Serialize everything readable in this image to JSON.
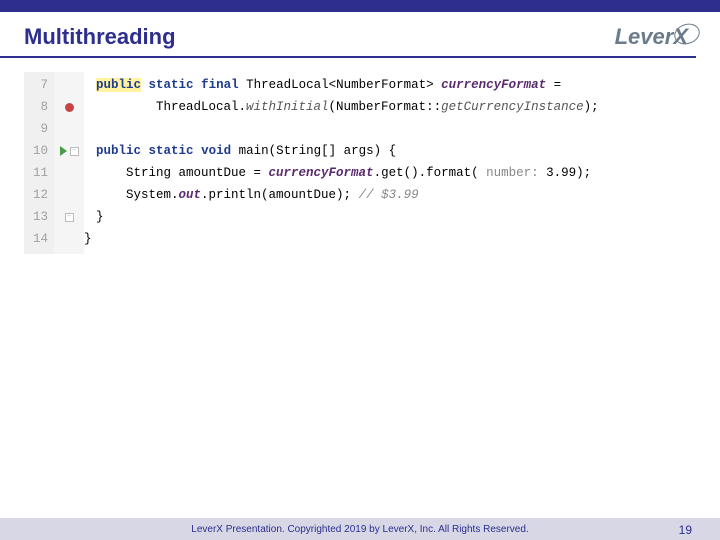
{
  "header": {
    "title": "Multithreading",
    "logo_text": "LeverX"
  },
  "code": {
    "line_numbers": [
      "7",
      "8",
      "9",
      "10",
      "11",
      "12",
      "13",
      "14"
    ],
    "l7": "public static final ThreadLocal<NumberFormat> currencyFormat =",
    "l7_kw_public": "public",
    "l7_kw_static": "static",
    "l7_kw_final": "final",
    "l7_type": " ThreadLocal<NumberFormat> ",
    "l7_field": "currencyFormat",
    "l7_eq": " =",
    "l8_pre": "        ThreadLocal.",
    "l8_mid": "withInitial",
    "l8_post": "(NumberFormat::",
    "l8_ital2": "getCurrencyInstance",
    "l8_end": ");",
    "l9": "",
    "l10_kw_public": "public",
    "l10_kw_static": "static",
    "l10_kw_void": "void",
    "l10_rest": " main(String[] args) {",
    "l11_pre": "    String amountDue = ",
    "l11_field": "currencyFormat",
    "l11_mid": ".get().format( ",
    "l11_hint": "number: ",
    "l11_num": "3.99",
    "l11_end": ");",
    "l12_pre": "    System.",
    "l12_out": "out",
    "l12_mid": ".println(amountDue); ",
    "l12_cmt": "// $3.99",
    "l13": "}",
    "l14": "}"
  },
  "footer": {
    "text": "LeverX Presentation. Copyrighted 2019 by LeverX, Inc. All Rights Reserved.",
    "page": "19"
  }
}
